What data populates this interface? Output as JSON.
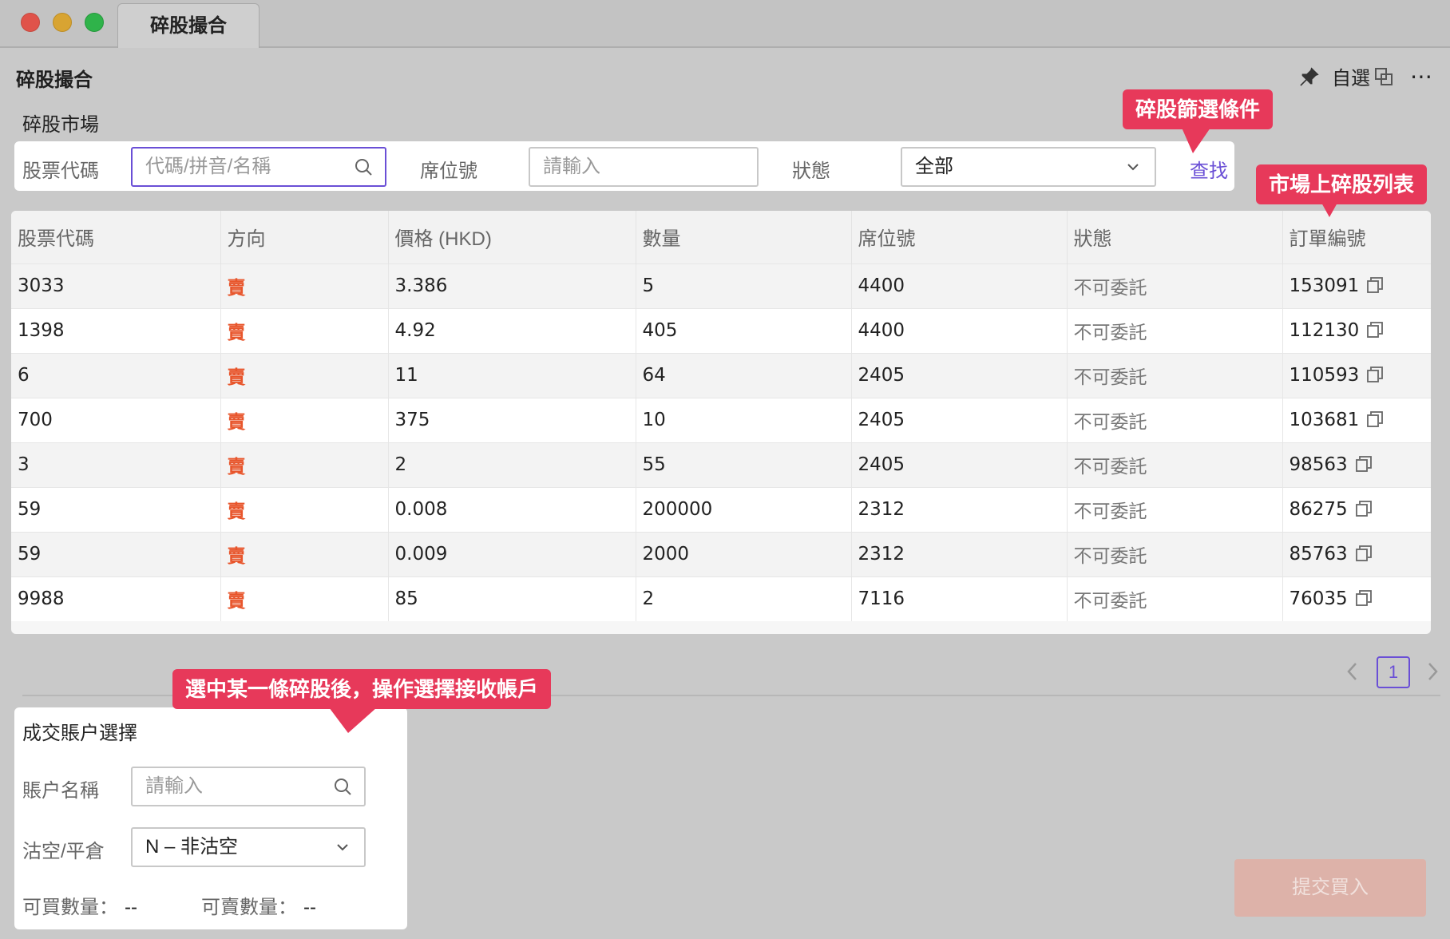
{
  "window": {
    "tab_label": "碎股撮合"
  },
  "header": {
    "title": "碎股撮合",
    "watchlist_label": "自選",
    "icons": [
      "pin-icon",
      "window-icon",
      "more-icon"
    ]
  },
  "filter": {
    "section_label": "碎股市場",
    "stock_code_label": "股票代碼",
    "stock_code_placeholder": "代碼/拼音/名稱",
    "seat_label": "席位號",
    "seat_placeholder": "請輸入",
    "status_label": "狀態",
    "status_value": "全部",
    "search_label": "查找"
  },
  "table": {
    "columns": [
      "股票代碼",
      "方向",
      "價格 (HKD)",
      "數量",
      "席位號",
      "狀態",
      "訂單編號"
    ],
    "rows": [
      [
        "3033",
        "賣",
        "3.386",
        "5",
        "4400",
        "不可委託",
        "153091"
      ],
      [
        "1398",
        "賣",
        "4.92",
        "405",
        "4400",
        "不可委託",
        "112130"
      ],
      [
        "6",
        "賣",
        "11",
        "64",
        "2405",
        "不可委託",
        "110593"
      ],
      [
        "700",
        "賣",
        "375",
        "10",
        "2405",
        "不可委託",
        "103681"
      ],
      [
        "3",
        "賣",
        "2",
        "55",
        "2405",
        "不可委託",
        "98563"
      ],
      [
        "59",
        "賣",
        "0.008",
        "200000",
        "2312",
        "不可委託",
        "86275"
      ],
      [
        "59",
        "賣",
        "0.009",
        "2000",
        "2312",
        "不可委託",
        "85763"
      ],
      [
        "9988",
        "賣",
        "85",
        "2",
        "7116",
        "不可委託",
        "76035"
      ]
    ]
  },
  "pagination": {
    "current_page": "1"
  },
  "account": {
    "title": "成交賬户選擇",
    "name_label": "賬户名稱",
    "name_placeholder": "請輸入",
    "short_label": "沽空/平倉",
    "short_value": "N – 非沽空",
    "buyable_label": "可買數量：",
    "buyable_value": "--",
    "sellable_label": "可賣數量：",
    "sellable_value": "--"
  },
  "submit": {
    "label": "提交買入"
  },
  "callouts": {
    "filter_note": "碎股篩選條件",
    "list_note": "市場上碎股列表",
    "account_note": "選中某一條碎股後，操作選擇接收帳戶"
  },
  "colors": {
    "accent": "#6a4fd6",
    "sell": "#e8552b",
    "callout": "#e7395a",
    "submit_disabled": "#ddb2a9"
  }
}
